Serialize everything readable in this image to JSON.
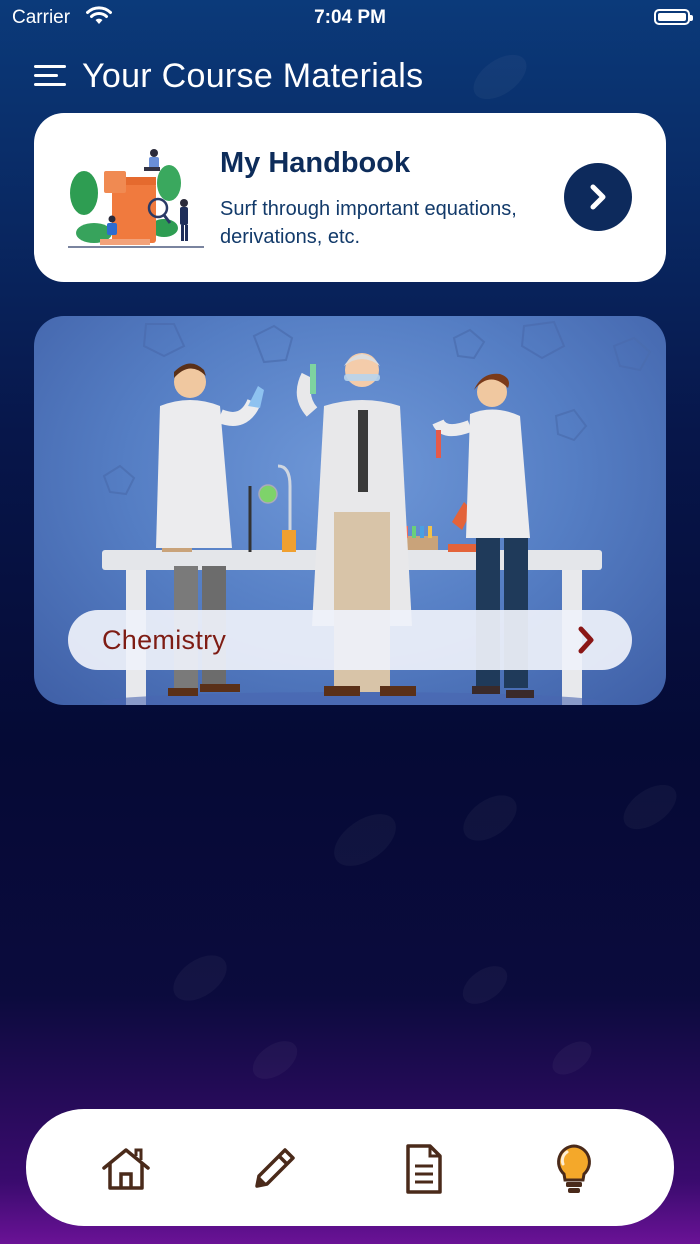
{
  "status_bar": {
    "carrier": "Carrier",
    "time": "7:04 PM"
  },
  "header": {
    "title": "Your Course Materials"
  },
  "handbook": {
    "title": "My Handbook",
    "description": "Surf through important equations, derivations, etc."
  },
  "subjects": [
    {
      "label": "Chemistry"
    }
  ],
  "nav": {
    "items": [
      {
        "icon": "home-icon"
      },
      {
        "icon": "pencil-icon"
      },
      {
        "icon": "document-icon"
      },
      {
        "icon": "lightbulb-icon"
      }
    ]
  },
  "colors": {
    "navy": "#0d2a5c",
    "chemistry_text": "#7e1c14",
    "icon_brown": "#4a2a1a",
    "bulb": "#f4a82a"
  }
}
